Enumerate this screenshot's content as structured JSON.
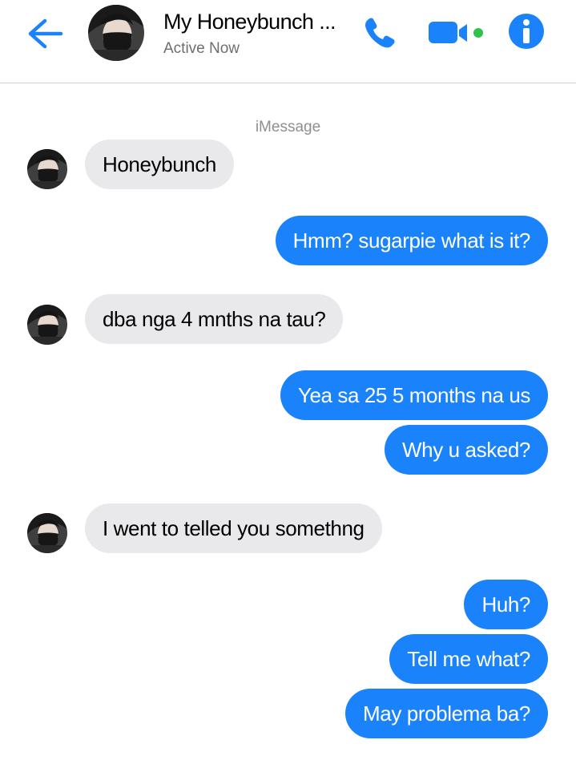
{
  "header": {
    "contact_name": "My Honeybunch ...",
    "status": "Active Now",
    "icons": {
      "back": "back-arrow-icon",
      "call": "phone-icon",
      "video": "video-camera-icon",
      "info": "info-icon"
    }
  },
  "conversation": {
    "service_label": "iMessage",
    "messages": [
      {
        "direction": "incoming",
        "text": "Honeybunch"
      },
      {
        "direction": "outgoing",
        "text": "Hmm? sugarpie what is it?"
      },
      {
        "direction": "incoming",
        "text": "dba nga 4 mnths na tau?"
      },
      {
        "direction": "outgoing",
        "text": "Yea sa 25 5 months na us"
      },
      {
        "direction": "outgoing",
        "text": "Why u asked?"
      },
      {
        "direction": "incoming",
        "text": "I went to telled you somethng"
      },
      {
        "direction": "outgoing",
        "text": "Huh?"
      },
      {
        "direction": "outgoing",
        "text": "Tell me what?"
      },
      {
        "direction": "outgoing",
        "text": "May problema ba?"
      }
    ]
  },
  "colors": {
    "accent_blue": "#1a82fb",
    "incoming_bubble": "#e9e9eb",
    "online_dot": "#31c24d"
  }
}
